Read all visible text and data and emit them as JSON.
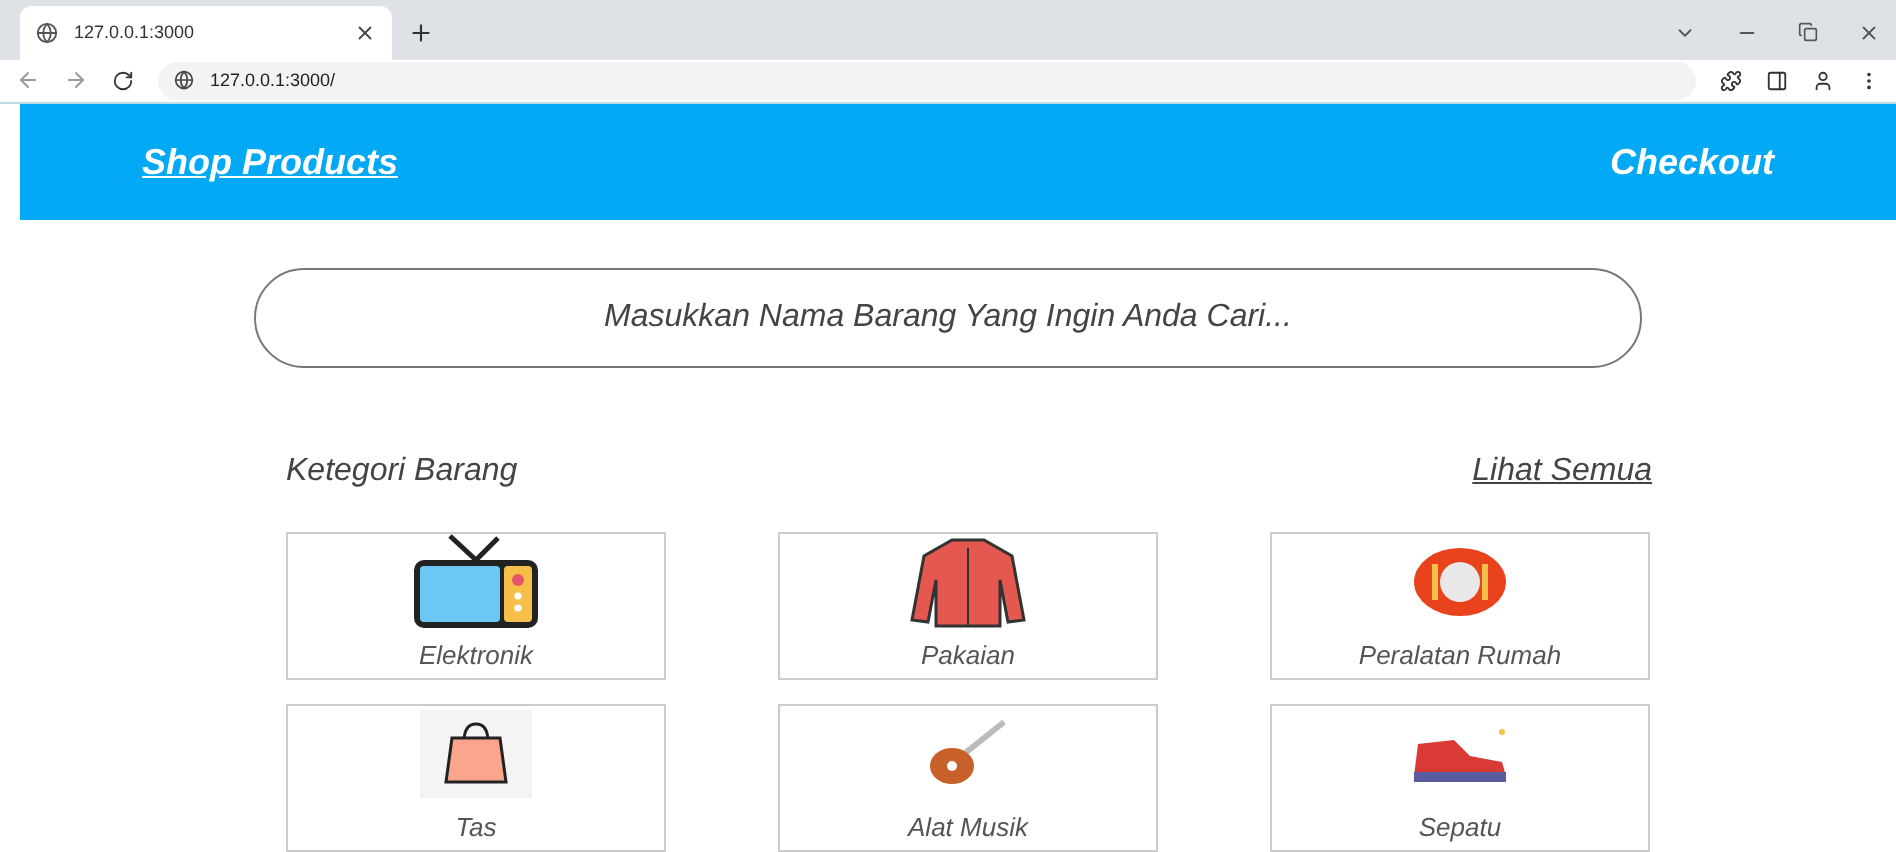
{
  "browser": {
    "tabs": [
      {
        "title": "127.0.0.1:3000",
        "selected": true
      }
    ],
    "url": "127.0.0.1:3000/"
  },
  "header": {
    "brand": "Shop Products",
    "checkout": "Checkout"
  },
  "search": {
    "placeholder": "Masukkan Nama Barang Yang Ingin Anda Cari..."
  },
  "categories": {
    "title": "Ketegori Barang",
    "see_all": "Lihat Semua",
    "items": [
      {
        "label": "Elektronik",
        "kind": "tv"
      },
      {
        "label": "Pakaian",
        "kind": "shirt"
      },
      {
        "label": "Peralatan Rumah",
        "kind": "plate"
      },
      {
        "label": "Tas",
        "kind": "bag"
      },
      {
        "label": "Alat Musik",
        "kind": "guitar"
      },
      {
        "label": "Sepatu",
        "kind": "shoe"
      }
    ]
  }
}
